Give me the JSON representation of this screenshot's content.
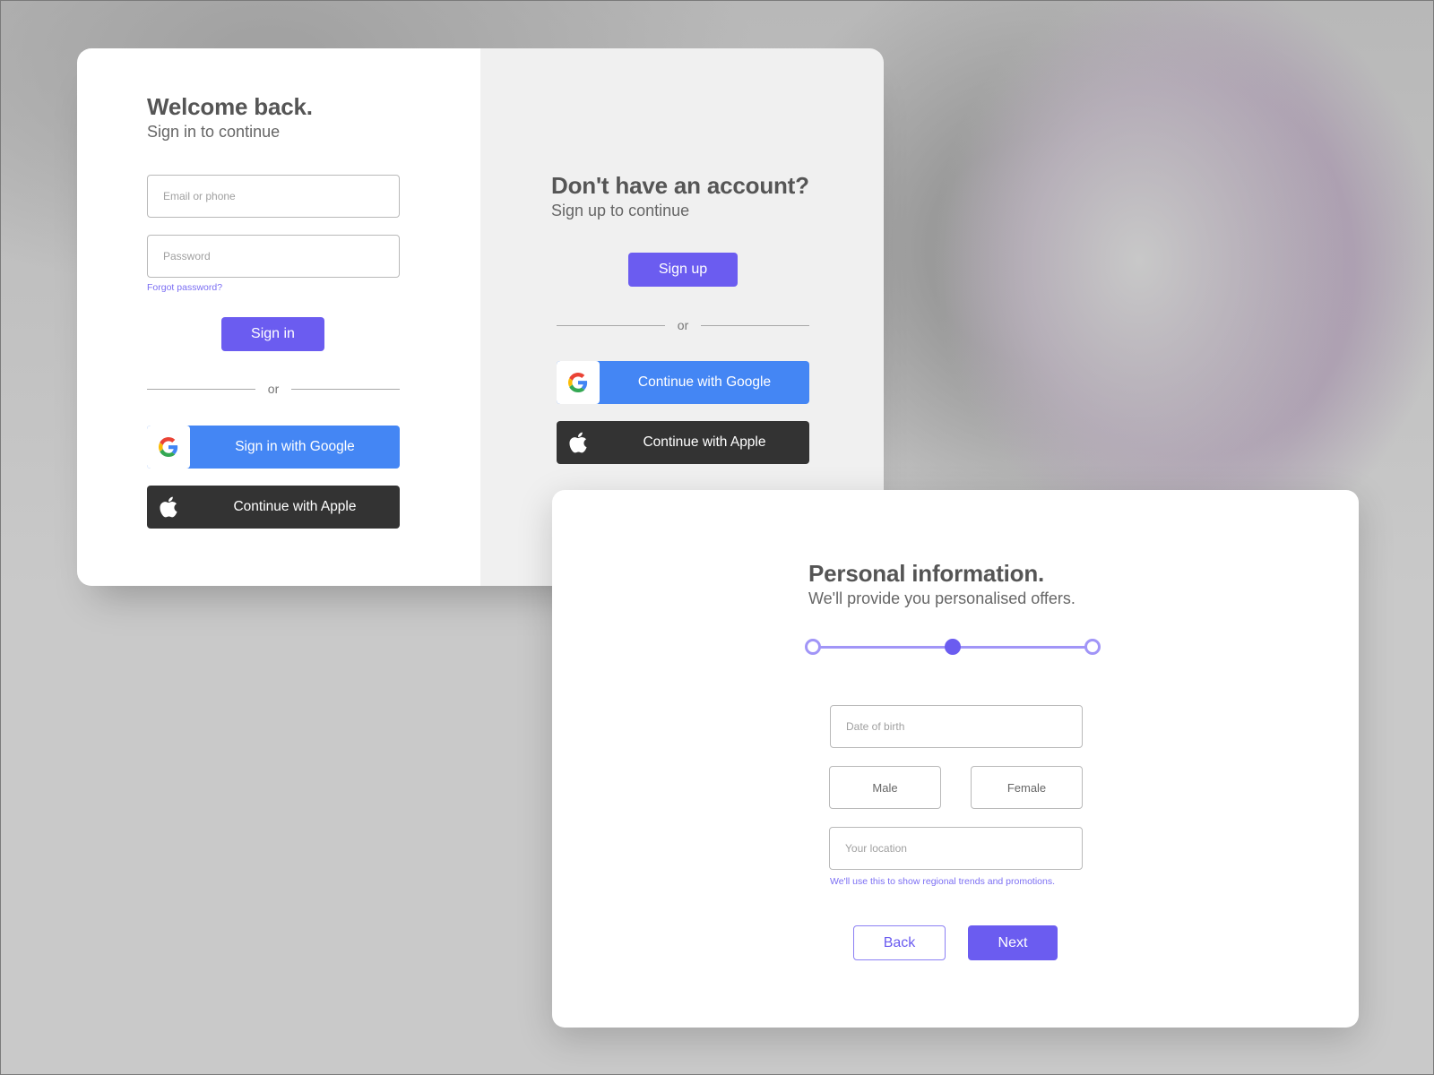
{
  "colors": {
    "accent": "#6b5cf0",
    "accent_light": "#a195f7",
    "google_blue": "#4486f4",
    "apple_dark": "#333333",
    "heading": "#555555"
  },
  "signin": {
    "title": "Welcome back.",
    "subtitle": "Sign in to continue",
    "email_placeholder": "Email or phone",
    "password_placeholder": "Password",
    "forgot_password": "Forgot password?",
    "submit_label": "Sign in",
    "divider_text": "or",
    "google_label": "Sign in with Google",
    "apple_label": "Continue with Apple"
  },
  "signup": {
    "title": "Don't have an account?",
    "subtitle": "Sign up to continue",
    "submit_label": "Sign up",
    "divider_text": "or",
    "google_label": "Continue with Google",
    "apple_label": "Continue with Apple"
  },
  "personal_info": {
    "title": "Personal information.",
    "subtitle": "We'll provide you personalised offers.",
    "stepper": {
      "total_steps": 3,
      "current_step": 2
    },
    "dob_placeholder": "Date of birth",
    "gender_options": [
      "Male",
      "Female"
    ],
    "location_placeholder": "Your location",
    "location_hint": "We'll use this to show regional trends and promotions.",
    "back_label": "Back",
    "next_label": "Next"
  },
  "icons": {
    "google": "google-g-logo",
    "apple": "apple-logo"
  }
}
